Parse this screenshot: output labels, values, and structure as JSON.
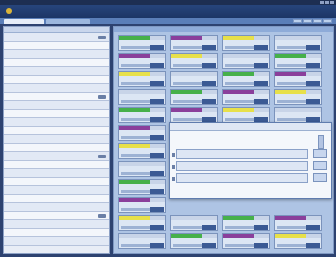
{
  "window": {
    "title": ""
  },
  "header": {
    "logo_text": "",
    "subtitle": ""
  },
  "sidebar": {
    "heading": "",
    "rows": [
      {
        "code": "",
        "name": ""
      },
      {
        "code": "",
        "name": ""
      },
      {
        "code": "",
        "name": ""
      },
      {
        "code": "",
        "name": ""
      },
      {
        "code": "",
        "name": ""
      },
      {
        "code": "",
        "name": ""
      },
      {
        "code": "",
        "name": ""
      },
      {
        "code": "",
        "name": ""
      },
      {
        "code": "",
        "name": ""
      },
      {
        "code": "",
        "name": ""
      },
      {
        "code": "",
        "name": ""
      },
      {
        "code": "",
        "name": ""
      },
      {
        "code": "",
        "name": ""
      },
      {
        "code": "",
        "name": ""
      },
      {
        "code": "",
        "name": ""
      },
      {
        "code": "",
        "name": ""
      },
      {
        "code": "",
        "name": ""
      },
      {
        "code": "",
        "name": ""
      },
      {
        "code": "",
        "name": ""
      },
      {
        "code": "",
        "name": ""
      },
      {
        "code": "",
        "name": ""
      },
      {
        "code": "",
        "name": ""
      },
      {
        "code": "",
        "name": ""
      },
      {
        "code": "",
        "name": ""
      },
      {
        "code": "",
        "name": ""
      }
    ]
  },
  "main": {
    "heading": ""
  },
  "dialog": {
    "title": "",
    "subtitle": "",
    "side_title": "",
    "items": [
      "",
      "",
      ""
    ],
    "close_label": ""
  },
  "colors": {
    "accent": "#2d4270",
    "card_bar": "#3b5a94",
    "status_green": "#46b04a",
    "status_yellow": "#e7e04a",
    "status_purple": "#8a3f9b"
  }
}
